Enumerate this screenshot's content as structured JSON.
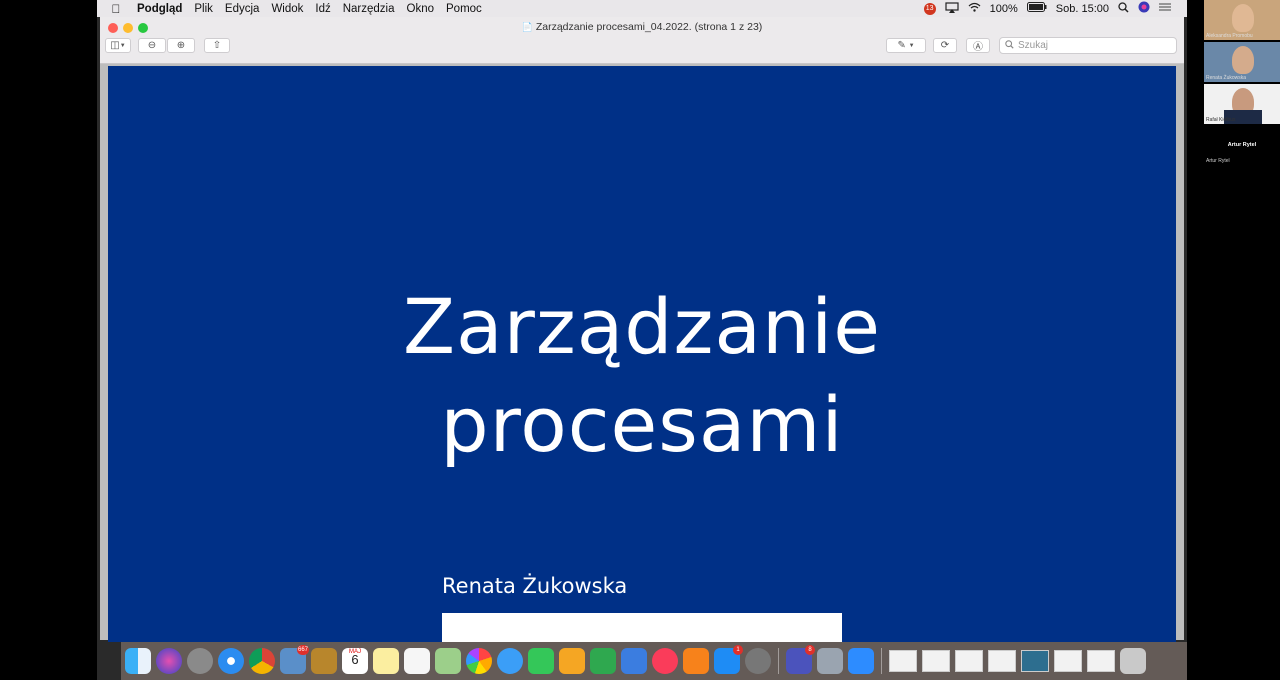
{
  "menubar": {
    "app": "Podgląd",
    "items": [
      "Plik",
      "Edycja",
      "Widok",
      "Idź",
      "Narzędzia",
      "Okno",
      "Pomoc"
    ],
    "battery": "100%",
    "clock": "Sob. 15:00",
    "notification_count": "13"
  },
  "window": {
    "title": "Zarządzanie procesami_04.2022. (strona 1 z 23)",
    "search_placeholder": "Szukaj"
  },
  "slide": {
    "title_line1": "Zarządzanie",
    "title_line2": "procesami",
    "author": "Renata Żukowska",
    "background": "#003087"
  },
  "dock": {
    "badges": {
      "mail": "667",
      "calendar_day": "6",
      "calendar_month": "MAJ",
      "appstore": "1",
      "teams": "8"
    }
  },
  "participants": [
    {
      "name": "Aleksandra Promobu"
    },
    {
      "name": "Renata Żukowska"
    },
    {
      "name": "Rafał Kiełbus"
    },
    {
      "name": "Artur Rytel",
      "label": "Artur Rytel"
    }
  ]
}
